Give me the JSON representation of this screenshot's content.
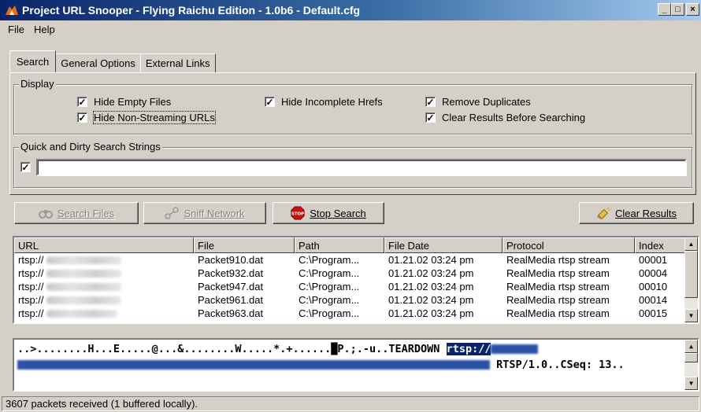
{
  "window": {
    "title": "Project URL Snooper - Flying Raichu Edition - 1.0b6 - Default.cfg",
    "minimize": "_",
    "maximize": "□",
    "close": "×"
  },
  "menu": [
    "File",
    "Help"
  ],
  "tabs": [
    "Search",
    "General Options",
    "External Links"
  ],
  "display_group": {
    "label": "Display",
    "options": [
      {
        "label": "Hide Empty Files",
        "checked": true
      },
      {
        "label": "Hide Non-Streaming URLs",
        "checked": true
      },
      {
        "label": "Hide Incomplete Hrefs",
        "checked": true
      },
      {
        "label": "Remove Duplicates",
        "checked": true
      },
      {
        "label": "Clear Results Before Searching",
        "checked": true
      }
    ]
  },
  "search_strings": {
    "label": "Quick and Dirty Search Strings",
    "enabled": true,
    "value": ""
  },
  "buttons": {
    "search_files": "Search Files",
    "sniff_network": "Sniff Network",
    "stop_search": "Stop Search",
    "stop_icon_text": "STOP",
    "clear_results": "Clear Results"
  },
  "results": {
    "columns": [
      "URL",
      "File",
      "Path",
      "File Date",
      "Protocol",
      "Index"
    ],
    "rows": [
      {
        "url": "rtsp://",
        "file": "Packet910.dat",
        "path": "C:\\Program...",
        "date": "01.21.02  03:24 pm",
        "protocol": "RealMedia rtsp stream",
        "index": "00001"
      },
      {
        "url": "rtsp://",
        "file": "Packet932.dat",
        "path": "C:\\Program...",
        "date": "01.21.02  03:24 pm",
        "protocol": "RealMedia rtsp stream",
        "index": "00004"
      },
      {
        "url": "rtsp://",
        "file": "Packet947.dat",
        "path": "C:\\Program...",
        "date": "01.21.02  03:24 pm",
        "protocol": "RealMedia rtsp stream",
        "index": "00010"
      },
      {
        "url": "rtsp://",
        "file": "Packet961.dat",
        "path": "C:\\Program...",
        "date": "01.21.02  03:24 pm",
        "protocol": "RealMedia rtsp stream",
        "index": "00014"
      },
      {
        "url": "rtsp://",
        "file": "Packet963.dat",
        "path": "C:\\Program...",
        "date": "01.21.02  03:24 pm",
        "protocol": "RealMedia rtsp stream",
        "index": "00015"
      }
    ]
  },
  "packet": {
    "line1": "..>........H...E.....@...&........W.....*.+......█P.;.-u..TEARDOWN ",
    "line1_selected": "rtsp://",
    "line2_tail": " RTSP/1.0..CSeq: 13.."
  },
  "status": "3607 packets received (1 buffered locally)."
}
